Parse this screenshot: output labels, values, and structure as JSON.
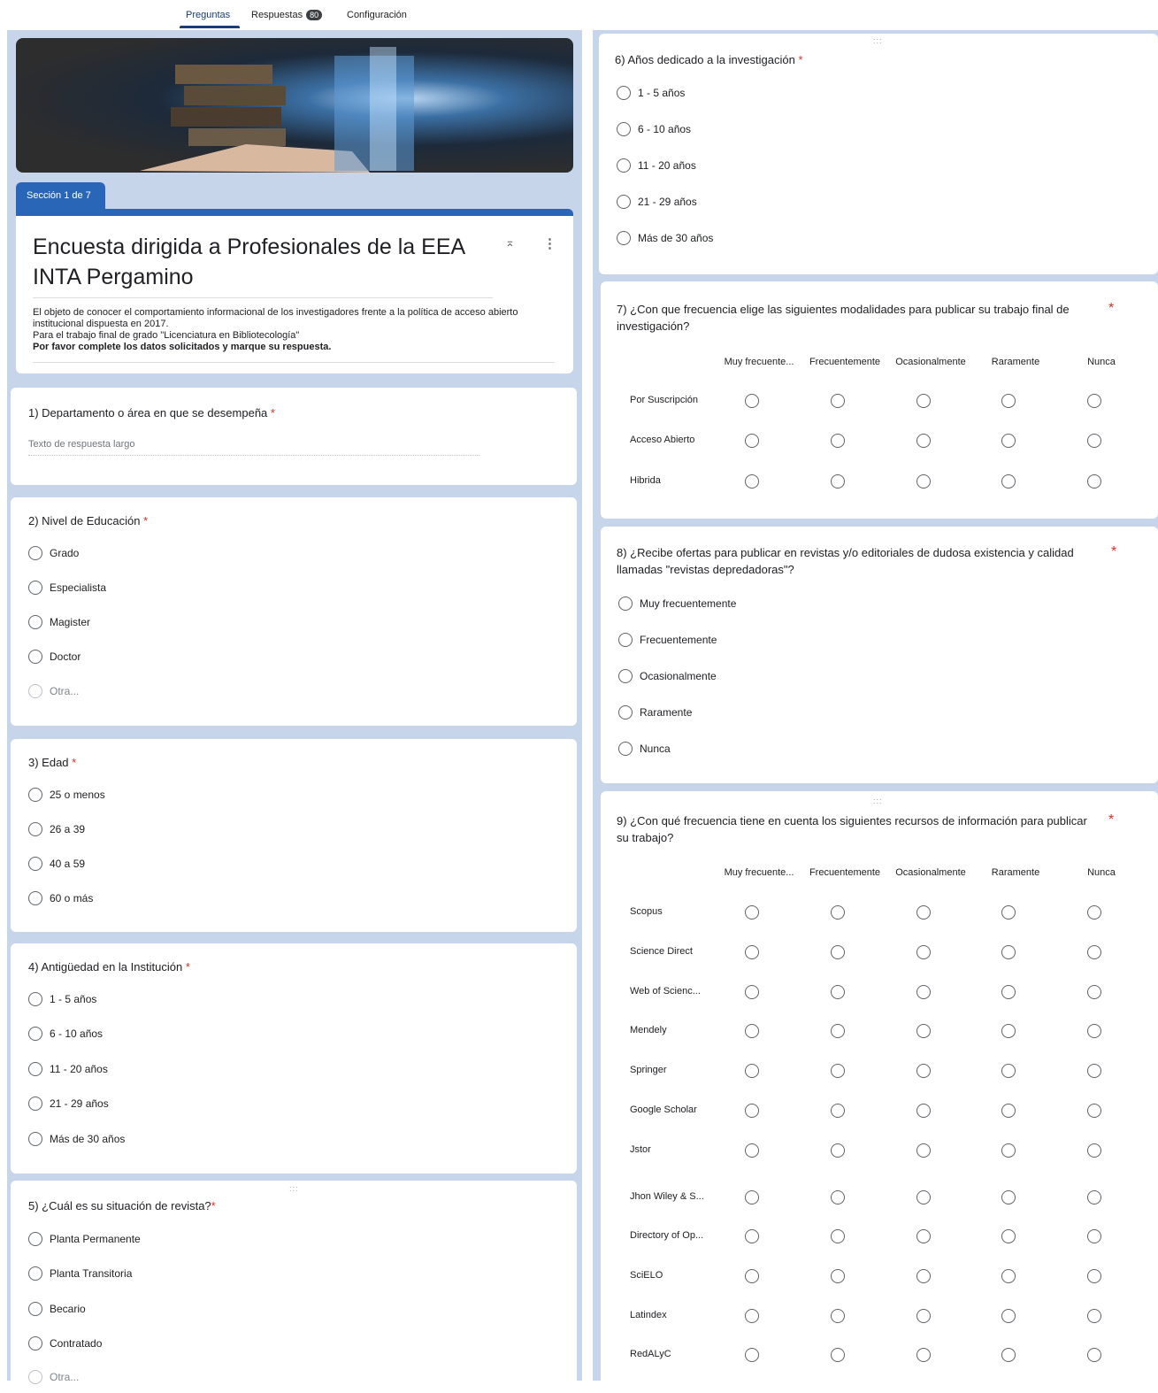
{
  "tabs": {
    "preguntas": "Preguntas",
    "respuestas": "Respuestas",
    "respuestas_count": "80",
    "configuracion": "Configuración"
  },
  "form": {
    "section": "Sección 1 de 7",
    "title": "Encuesta dirigida a Profesionales de la EEA INTA Pergamino",
    "desc_line1": "El objeto de conocer el comportamiento informacional de los investigadores frente a la política de acceso abierto institucional dispuesta en 2017.",
    "desc_line2": "Para el trabajo final de grado \"Licenciatura en Bibliotecología\"",
    "desc_line3": "Por favor complete los datos solicitados y marque su respuesta."
  },
  "required_mark": "*",
  "q1": {
    "title": "1) Departamento o área en que se desempeña",
    "placeholder": "Texto de respuesta largo"
  },
  "q2": {
    "title": "2)   Nivel de Educación",
    "options": [
      "Grado",
      "Especialista",
      "Magister",
      "Doctor"
    ],
    "other": "Otra..."
  },
  "q3": {
    "title": "3)   Edad",
    "options": [
      "25 o menos",
      "26 a 39",
      "40 a 59",
      "60 o más"
    ]
  },
  "q4": {
    "title": "4)   Antigüedad en la Institución",
    "options": [
      "1 - 5 años",
      "6 - 10 años",
      "11 - 20 años",
      "21 - 29 años",
      "Más de 30 años"
    ]
  },
  "q5": {
    "title": "5)   ¿Cuál es su situación de revista?",
    "options": [
      "Planta Permanente",
      "Planta Transitoria",
      "Becario",
      "Contratado"
    ],
    "other": "Otra..."
  },
  "q6": {
    "title": "6)   Años dedicado a la investigación",
    "options": [
      "1 - 5 años",
      "6 - 10 años",
      "11 - 20 años",
      "21 - 29 años",
      "Más de 30 años"
    ]
  },
  "q7": {
    "title_line1": "7)   ¿Con que frecuencia elige las siguientes modalidades para publicar su trabajo final de",
    "title_line2": "investigación?",
    "columns": [
      "Muy frecuente...",
      "Frecuentemente",
      "Ocasionalmente",
      "Raramente",
      "Nunca"
    ],
    "rows": [
      "Por Suscripción",
      "Acceso Abierto",
      "Hibrida"
    ]
  },
  "q8": {
    "title_line1": "8)   ¿Recibe ofertas para publicar en revistas y/o editoriales de dudosa existencia y calidad",
    "title_line2": "llamadas \"revistas depredadoras\"?",
    "options": [
      "Muy frecuentemente",
      "Frecuentemente",
      "Ocasionalmente",
      "Raramente",
      "Nunca"
    ]
  },
  "q9": {
    "title_line1": "9)   ¿Con qué frecuencia tiene en cuenta los siguientes recursos de información para publicar",
    "title_line2": "su trabajo?",
    "columns": [
      "Muy frecuente...",
      "Frecuentemente",
      "Ocasionalmente",
      "Raramente",
      "Nunca"
    ],
    "rows": [
      "Scopus",
      "Science Direct",
      "Web of Scienc...",
      "Mendely",
      "Springer",
      "Google Scholar",
      "Jstor",
      "Jhon Wiley & S...",
      "Directory of Op...",
      "SciELO",
      "Latindex",
      "RedALyC"
    ]
  },
  "icons": {
    "collapse": "collapse-icon",
    "more": "more-vert-icon",
    "drag": "drag-handle-icon"
  }
}
